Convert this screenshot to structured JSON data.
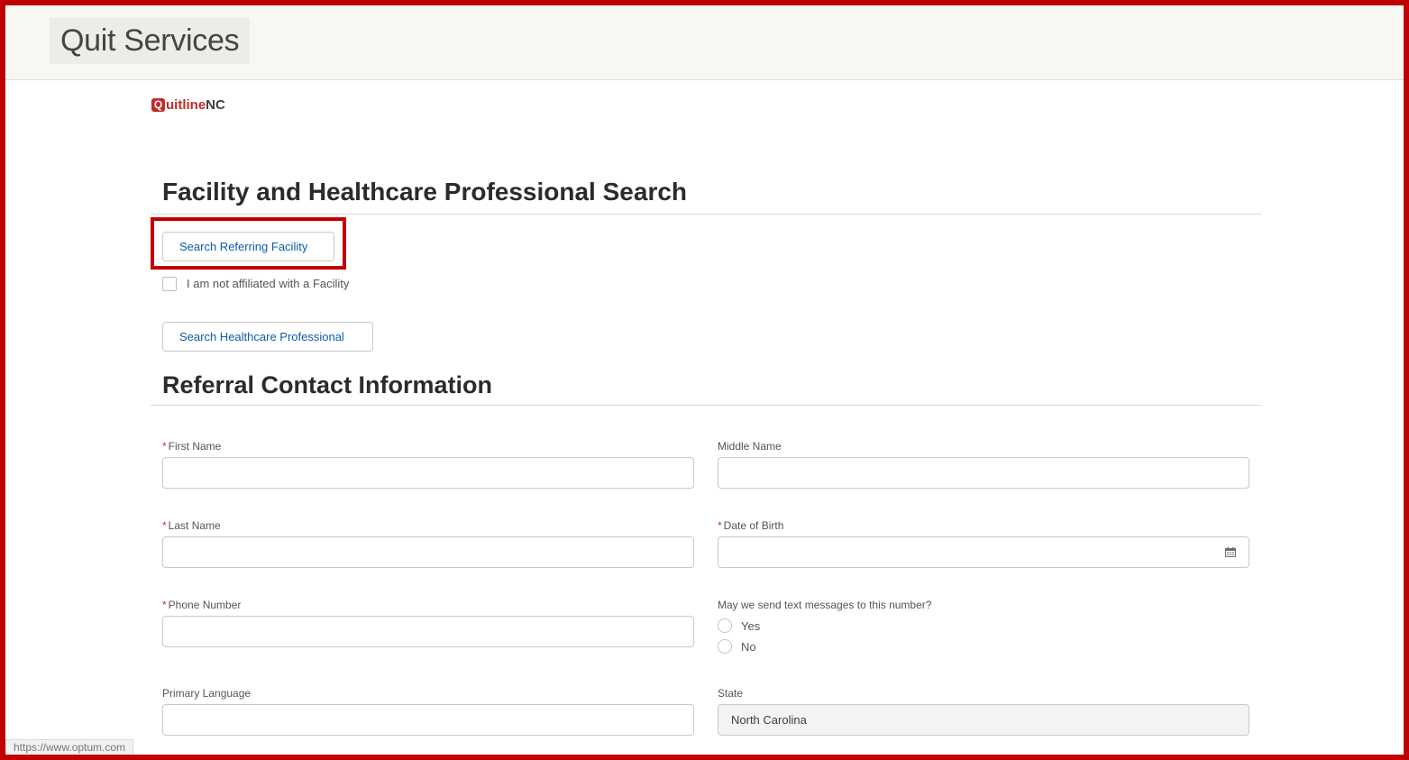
{
  "header": {
    "title": "Quit Services"
  },
  "logo": {
    "q": "Q",
    "quitline": "uitline",
    "nc": "NC"
  },
  "search_section": {
    "title": "Facility and Healthcare Professional Search",
    "facility_button": "Search Referring Facility",
    "not_affiliated_label": "I am not affiliated with a Facility",
    "professional_button": "Search Healthcare Professional"
  },
  "contact_section": {
    "title": "Referral Contact Information",
    "required_marker": "*",
    "first_name": {
      "label": "First Name",
      "value": ""
    },
    "middle_name": {
      "label": "Middle Name",
      "value": ""
    },
    "last_name": {
      "label": "Last Name",
      "value": ""
    },
    "dob": {
      "label": "Date of Birth",
      "value": ""
    },
    "phone": {
      "label": "Phone Number",
      "value": ""
    },
    "text_question": {
      "label": "May we send text messages to this number?",
      "options": [
        "Yes",
        "No"
      ]
    },
    "primary_language": {
      "label": "Primary Language",
      "value": ""
    },
    "state": {
      "label": "State",
      "value": "North Carolina"
    }
  },
  "status_bar": {
    "url": "https://www.optum.com"
  },
  "colors": {
    "highlight_border": "#c00000",
    "link_blue": "#0b5cab",
    "required_red": "#c23934",
    "brand_red": "#c62828"
  }
}
